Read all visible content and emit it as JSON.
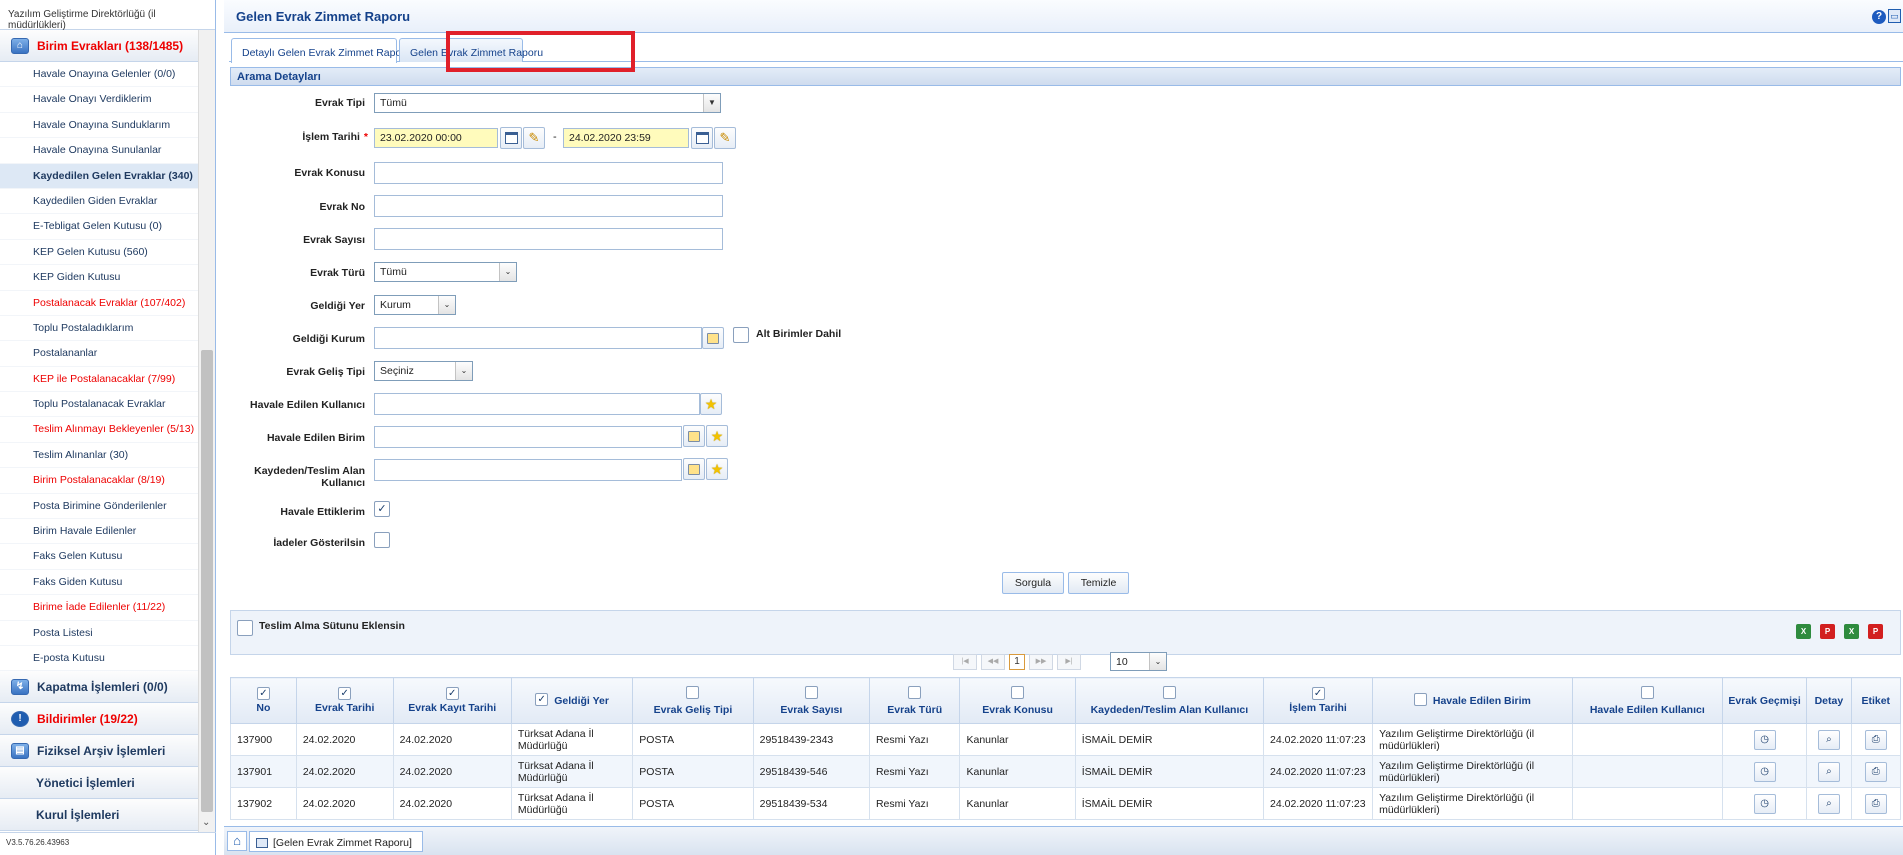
{
  "sidebar": {
    "org": "Yazılım Geliştirme Direktörlüğü (il müdürlükleri)",
    "group1_title": "Birim Evrakları (138/1485)",
    "items": [
      {
        "label": "Havale Onayına Gelenler (0/0)",
        "red": false
      },
      {
        "label": "Havale Onayı Verdiklerim",
        "red": false
      },
      {
        "label": "Havale Onayına Sunduklarım",
        "red": false
      },
      {
        "label": "Havale Onayına Sunulanlar",
        "red": false
      },
      {
        "label": "Kaydedilen Gelen Evraklar (340)",
        "red": false,
        "active": true
      },
      {
        "label": "Kaydedilen Giden Evraklar",
        "red": false
      },
      {
        "label": "E-Tebligat Gelen Kutusu (0)",
        "red": false
      },
      {
        "label": "KEP Gelen Kutusu (560)",
        "red": false
      },
      {
        "label": "KEP Giden Kutusu",
        "red": false
      },
      {
        "label": "Postalanacak Evraklar (107/402)",
        "red": true
      },
      {
        "label": "Toplu Postaladıklarım",
        "red": false
      },
      {
        "label": "Postalananlar",
        "red": false
      },
      {
        "label": "KEP ile Postalanacaklar (7/99)",
        "red": true
      },
      {
        "label": "Toplu Postalanacak Evraklar",
        "red": false
      },
      {
        "label": "Teslim Alınmayı Bekleyenler (5/13)",
        "red": true
      },
      {
        "label": "Teslim Alınanlar (30)",
        "red": false
      },
      {
        "label": "Birim Postalanacaklar (8/19)",
        "red": true
      },
      {
        "label": "Posta Birimine Gönderilenler",
        "red": false
      },
      {
        "label": "Birim Havale Edilenler",
        "red": false
      },
      {
        "label": "Faks Gelen Kutusu",
        "red": false
      },
      {
        "label": "Faks Giden Kutusu",
        "red": false
      },
      {
        "label": "Birime İade Edilenler (11/22)",
        "red": true
      },
      {
        "label": "Posta Listesi",
        "red": false
      },
      {
        "label": "E-posta Kutusu",
        "red": false
      }
    ],
    "group2_title": "Kapatma İşlemleri (0/0)",
    "group3_title": "Bildirimler (19/22)",
    "group4_title": "Fiziksel Arşiv İşlemleri",
    "group5_title": "Yönetici İşlemleri",
    "group6_title": "Kurul İşlemleri",
    "version": "V3.5.76.26.43963"
  },
  "page": {
    "title": "Gelen Evrak Zimmet Raporu",
    "tabs": [
      "Detaylı Gelen Evrak Zimmet Raporu",
      "Gelen Evrak Zimmet Raporu"
    ],
    "section_title": "Arama Detayları"
  },
  "form": {
    "evrak_tipi_label": "Evrak Tipi",
    "evrak_tipi_value": "Tümü",
    "islem_tarihi_label": "İşlem Tarihi",
    "required_mark": "*",
    "date_from": "23.02.2020 00:00",
    "date_sep": "-",
    "date_to": "24.02.2020 23:59",
    "evrak_konusu_label": "Evrak Konusu",
    "evrak_no_label": "Evrak No",
    "evrak_sayisi_label": "Evrak Sayısı",
    "evrak_turu_label": "Evrak Türü",
    "evrak_turu_value": "Tümü",
    "geldigi_yer_label": "Geldiği Yer",
    "geldigi_yer_value": "Kurum",
    "geldigi_kurum_label": "Geldiği Kurum",
    "alt_birimler_label": "Alt Birimler Dahil",
    "gelis_tipi_label": "Evrak Geliş Tipi",
    "gelis_tipi_value": "Seçiniz",
    "havale_kullanici_label": "Havale Edilen Kullanıcı",
    "havale_birim_label": "Havale Edilen Birim",
    "kaydeden_label": "Kaydeden/Teslim Alan Kullanıcı",
    "havale_ettiklerim_label": "Havale Ettiklerim",
    "iadeler_label": "İadeler Gösterilsin",
    "sorgula": "Sorgula",
    "temizle": "Temizle"
  },
  "results": {
    "teslim_alma_label": "Teslim Alma Sütunu Eklensin",
    "page_number": "1",
    "page_size": "10",
    "columns": [
      "No",
      "Evrak Tarihi",
      "Evrak Kayıt Tarihi",
      "Geldiği Yer",
      "Evrak Geliş Tipi",
      "Evrak Sayısı",
      "Evrak Türü",
      "Evrak Konusu",
      "Kaydeden/Teslim Alan Kullanıcı",
      "İşlem Tarihi",
      "Havale Edilen Birim",
      "Havale Edilen Kullanıcı",
      "Evrak Geçmişi",
      "Detay",
      "Etiket"
    ],
    "rows": [
      {
        "no": "137900",
        "evrak_tarihi": "24.02.2020",
        "kayit_tarihi": "24.02.2020",
        "geldigi_yer": "Türksat Adana İl Müdürlüğü",
        "gelis_tipi": "POSTA",
        "sayi": "29518439-2343",
        "tur": "Resmi Yazı",
        "konu": "Kanunlar",
        "kaydeden": "İSMAİL DEMİR",
        "islem_tarihi": "24.02.2020 11:07:23",
        "havale_birim": "Yazılım Geliştirme Direktörlüğü (il müdürlükleri)",
        "havale_kullanici": ""
      },
      {
        "no": "137901",
        "evrak_tarihi": "24.02.2020",
        "kayit_tarihi": "24.02.2020",
        "geldigi_yer": "Türksat Adana İl Müdürlüğü",
        "gelis_tipi": "POSTA",
        "sayi": "29518439-546",
        "tur": "Resmi Yazı",
        "konu": "Kanunlar",
        "kaydeden": "İSMAİL DEMİR",
        "islem_tarihi": "24.02.2020 11:07:23",
        "havale_birim": "Yazılım Geliştirme Direktörlüğü (il müdürlükleri)",
        "havale_kullanici": ""
      },
      {
        "no": "137902",
        "evrak_tarihi": "24.02.2020",
        "kayit_tarihi": "24.02.2020",
        "geldigi_yer": "Türksat Adana İl Müdürlüğü",
        "gelis_tipi": "POSTA",
        "sayi": "29518439-534",
        "tur": "Resmi Yazı",
        "konu": "Kanunlar",
        "kaydeden": "İSMAİL DEMİR",
        "islem_tarihi": "24.02.2020 11:07:23",
        "havale_birim": "Yazılım Geliştirme Direktörlüğü (il müdürlükleri)",
        "havale_kullanici": ""
      }
    ]
  },
  "taskbar": {
    "tab_label": "[Gelen Evrak Zimmet Raporu]"
  },
  "colors": {
    "accent": "#15428b",
    "highlight_box": "#e0202a",
    "red_link": "#e00000",
    "date_field": "#fffbbc"
  },
  "icons": [
    "home-icon",
    "calendar-icon",
    "broom-icon",
    "tree-select-icon",
    "favorite-star-icon",
    "help-icon",
    "excel-export-icon",
    "pdf-export-icon",
    "history-icon",
    "detail-search-icon",
    "print-label-icon"
  ]
}
